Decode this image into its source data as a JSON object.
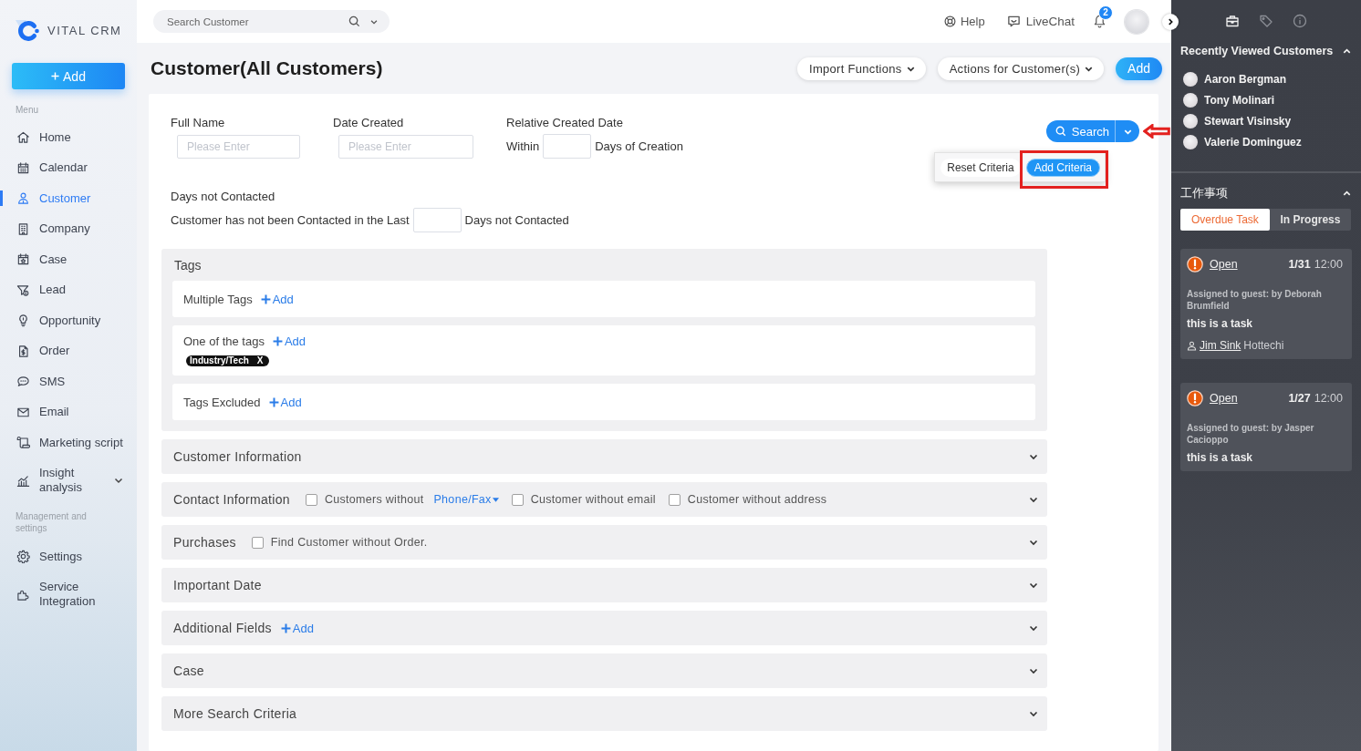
{
  "sidebar": {
    "brand": "VITAL CRM",
    "add_button": "Add",
    "menu_label": "Menu",
    "items": [
      {
        "label": "Home",
        "kind": "link",
        "selected": false
      },
      {
        "label": "Calendar",
        "kind": "link",
        "selected": false
      },
      {
        "label": "Customer",
        "kind": "link",
        "selected": true
      },
      {
        "label": "Company",
        "kind": "link",
        "selected": false
      },
      {
        "label": "Case",
        "kind": "link",
        "selected": false
      },
      {
        "label": "Lead",
        "kind": "link",
        "selected": false
      },
      {
        "label": "Opportunity",
        "kind": "link",
        "selected": false
      },
      {
        "label": "Order",
        "kind": "link",
        "selected": false
      },
      {
        "label": "SMS",
        "kind": "link",
        "selected": false
      },
      {
        "label": "Email",
        "kind": "link",
        "selected": false
      },
      {
        "label": "Marketing script",
        "kind": "link",
        "selected": false
      },
      {
        "label": "Insight analysis",
        "kind": "group",
        "selected": false,
        "expanded": false
      }
    ],
    "settings_label": "Management and settings",
    "settings_items": [
      {
        "label": "Settings",
        "selected": false
      },
      {
        "label": "Service Integration",
        "selected": false
      }
    ]
  },
  "top_bar": {
    "search": {
      "placeholder": "Search Customer"
    },
    "help": "Help",
    "livechat": "LiveChat",
    "notification_count": "2"
  },
  "header": {
    "title": "Customer(All Customers)",
    "buttons": [
      {
        "label": "Import Functions",
        "kind": "menu"
      },
      {
        "label": "Actions for Customer(s)",
        "kind": "menu"
      },
      {
        "label": "Add",
        "kind": "primary"
      }
    ]
  },
  "filters": {
    "fields": [
      {
        "label": "Full Name",
        "placeholder": "Please Enter"
      },
      {
        "label": "Date Created",
        "placeholder": "Please Enter"
      }
    ],
    "relative_date": {
      "label": "Relative Created Date",
      "prefix": "Within",
      "suffix": "Days of Creation"
    },
    "search_button": {
      "label": "Search",
      "annotated": true
    },
    "search_menu": [
      {
        "label": "Reset Criteria",
        "kind": "plain",
        "annotated": false
      },
      {
        "label": "Add Criteria",
        "kind": "primary",
        "annotated": true
      }
    ],
    "days_not_contacted": {
      "label": "Days not Contacted",
      "prefix": "Customer has not been Contacted in the Last",
      "suffix": "Days not Contacted"
    }
  },
  "tags": {
    "title": "Tags",
    "rows": [
      {
        "label": "Multiple Tags",
        "add": "Add"
      },
      {
        "label": "One of the tags",
        "add": "Add",
        "chips": [
          {
            "label": "Industry/Tech",
            "remove": "X"
          }
        ]
      },
      {
        "label": "Tags Excluded",
        "add": "Add"
      }
    ]
  },
  "sections": [
    {
      "title": "Customer Information",
      "expanded": false
    },
    {
      "title": "Contact Information",
      "expanded": false,
      "options": [
        {
          "label": "Customers without",
          "link": "Phone/Fax",
          "checked": false
        },
        {
          "label": "Customer without email",
          "checked": false
        },
        {
          "label": "Customer without address",
          "checked": false
        }
      ]
    },
    {
      "title": "Purchases",
      "expanded": false,
      "options": [
        {
          "label": "Find Customer without Order.",
          "checked": false
        }
      ]
    },
    {
      "title": "Important Date",
      "expanded": false
    },
    {
      "title": "Additional Fields",
      "expanded": false,
      "add": "Add"
    },
    {
      "title": "Case",
      "expanded": false
    },
    {
      "title": "More Search Criteria",
      "expanded": false
    }
  ],
  "panel": {
    "tabs": [
      {
        "selected": true
      },
      {
        "selected": false
      },
      {
        "selected": false
      }
    ],
    "recent": {
      "title": "Recently Viewed Customers",
      "expanded": true,
      "customers": [
        "Aaron Bergman",
        "Tony Molinari",
        "Stewart Visinsky",
        "Valerie Dominguez"
      ]
    },
    "tasks": {
      "title": "工作事项",
      "expanded": true,
      "tabs": [
        {
          "label": "Overdue Task",
          "selected": true
        },
        {
          "label": "In Progress",
          "selected": false
        }
      ],
      "items": [
        {
          "status": "Open",
          "date": "1/31",
          "time": "12:00",
          "assigned": "Assigned to guest: by Deborah Brumfield",
          "text": "this is a task",
          "contact_name": "Jim Sink",
          "contact_company": "Hottechi"
        },
        {
          "status": "Open",
          "date": "1/27",
          "time": "12:00",
          "assigned": "Assigned to guest: by Jasper Cacioppo",
          "text": "this is a task"
        }
      ]
    }
  }
}
